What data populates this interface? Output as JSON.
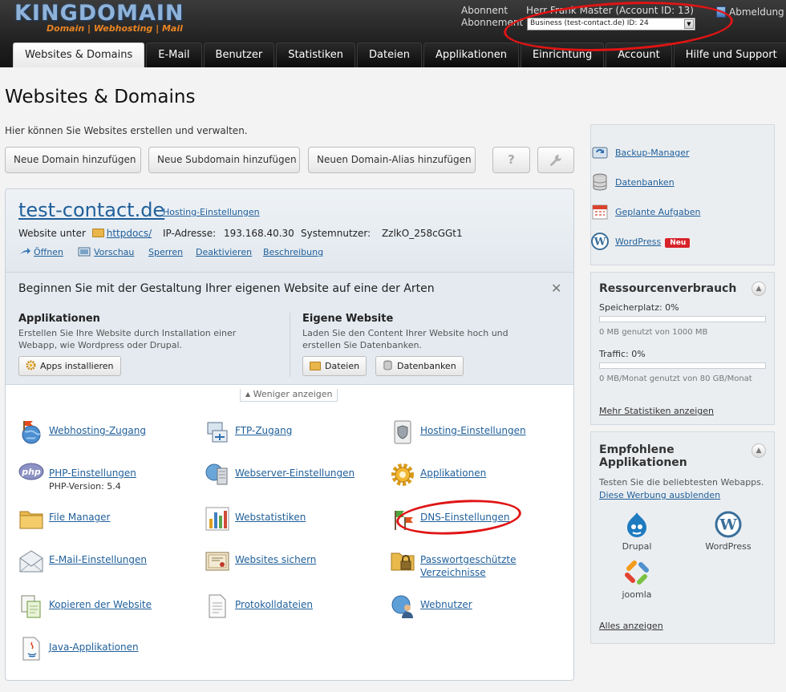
{
  "header": {
    "logo_text": "KINGDOMAIN",
    "logo_tagline": "Domain | Webhosting | Mail",
    "subscriber_label": "Abonnent",
    "subscriber_name": "Herr Frank Master (Account ID: 13)",
    "subscription_label": "Abonnement",
    "subscription_value": "Business (test-contact.de) ID: 24",
    "logout_label": "Abmeldung"
  },
  "tabs": [
    {
      "label": "Websites & Domains",
      "active": true
    },
    {
      "label": "E-Mail"
    },
    {
      "label": "Benutzer"
    },
    {
      "label": "Statistiken"
    },
    {
      "label": "Dateien"
    },
    {
      "label": "Applikationen"
    },
    {
      "label": "Einrichtung"
    },
    {
      "label": "Account"
    },
    {
      "label": "Hilfe und Support"
    }
  ],
  "page": {
    "title": "Websites & Domains",
    "description": "Hier können Sie Websites erstellen und verwalten.",
    "buttons": {
      "new_domain": "Neue Domain hinzufügen",
      "new_subdomain": "Neue Subdomain hinzufügen",
      "new_alias": "Neuen Domain-Alias hinzufügen",
      "help": "?"
    }
  },
  "domain": {
    "name": "test-contact.de",
    "hosting_link": "Hosting-Einstellungen",
    "website_under_label": "Website unter",
    "docroot": "httpdocs/",
    "ip_label": "IP-Adresse:",
    "ip": "193.168.40.30",
    "sysuser_label": "Systemnutzer:",
    "sysuser": "ZzlkO_258cGGt1",
    "actions": [
      "Öffnen",
      "Vorschau",
      "Sperren",
      "Deaktivieren",
      "Beschreibung"
    ]
  },
  "starter": {
    "title": "Beginnen Sie mit der Gestaltung Ihrer eigenen Website auf eine der Arten",
    "close": "✕",
    "apps_title": "Applikationen",
    "apps_text": "Erstellen Sie Ihre Website durch Installation einer Webapp, wie Wordpress oder Drupal.",
    "apps_button": "Apps installieren",
    "own_title": "Eigene Website",
    "own_text": "Laden Sie den Content Ihrer Website hoch und erstellen Sie Datenbanken.",
    "files_button": "Dateien",
    "db_button": "Datenbanken",
    "less_toggle": "Weniger anzeigen"
  },
  "tools": [
    {
      "label": "Webhosting-Zugang",
      "icon": "globe-icon"
    },
    {
      "label": "FTP-Zugang",
      "icon": "ftp-icon"
    },
    {
      "label": "Hosting-Einstellungen",
      "icon": "shield-icon"
    },
    {
      "label": "PHP-Einstellungen",
      "sub": "PHP-Version: 5.4",
      "icon": "php-icon"
    },
    {
      "label": "Webserver-Einstellungen",
      "icon": "server-icon"
    },
    {
      "label": "Applikationen",
      "icon": "gear-icon"
    },
    {
      "label": "File Manager",
      "icon": "folder-icon"
    },
    {
      "label": "Webstatistiken",
      "icon": "chart-icon"
    },
    {
      "label": "DNS-Einstellungen",
      "icon": "dns-icon"
    },
    {
      "label": "E-Mail-Einstellungen",
      "icon": "mail-icon"
    },
    {
      "label": "Websites sichern",
      "icon": "certificate-icon"
    },
    {
      "label": "Passwortgeschützte Verzeichnisse",
      "icon": "lock-folder-icon"
    },
    {
      "label": "Kopieren der Website",
      "icon": "copy-icon"
    },
    {
      "label": "Protokolldateien",
      "icon": "log-icon"
    },
    {
      "label": "Webnutzer",
      "icon": "webuser-icon"
    },
    {
      "label": "Java-Applikationen",
      "icon": "java-icon"
    }
  ],
  "sidebar": {
    "links": [
      {
        "label": "Backup-Manager",
        "icon": "backup-icon"
      },
      {
        "label": "Datenbanken",
        "icon": "database-icon"
      },
      {
        "label": "Geplante Aufgaben",
        "icon": "calendar-icon"
      },
      {
        "label": "WordPress",
        "icon": "wordpress-icon",
        "badge": "Neu"
      }
    ],
    "resources": {
      "title": "Ressourcenverbrauch",
      "storage_label": "Speicherplatz: 0%",
      "storage_percent": 0,
      "storage_sub": "0 MB genutzt von 1000 MB",
      "traffic_label": "Traffic: 0%",
      "traffic_percent": 0,
      "traffic_sub": "0 MB/Monat genutzt von 80 GB/Monat",
      "more_link": "Mehr Statistiken anzeigen"
    },
    "recommended": {
      "title": "Empfohlene Applikationen",
      "text": "Testen Sie die beliebtesten Webapps.",
      "hide_link": "Diese Werbung ausblenden",
      "apps": [
        "Drupal",
        "WordPress",
        "joomla"
      ],
      "all_link": "Alles anzeigen"
    }
  },
  "colors": {
    "header_bg": "#1d1d1d",
    "link": "#1f5f9a",
    "annotation": "#e01414",
    "badge": "#d8232a"
  }
}
